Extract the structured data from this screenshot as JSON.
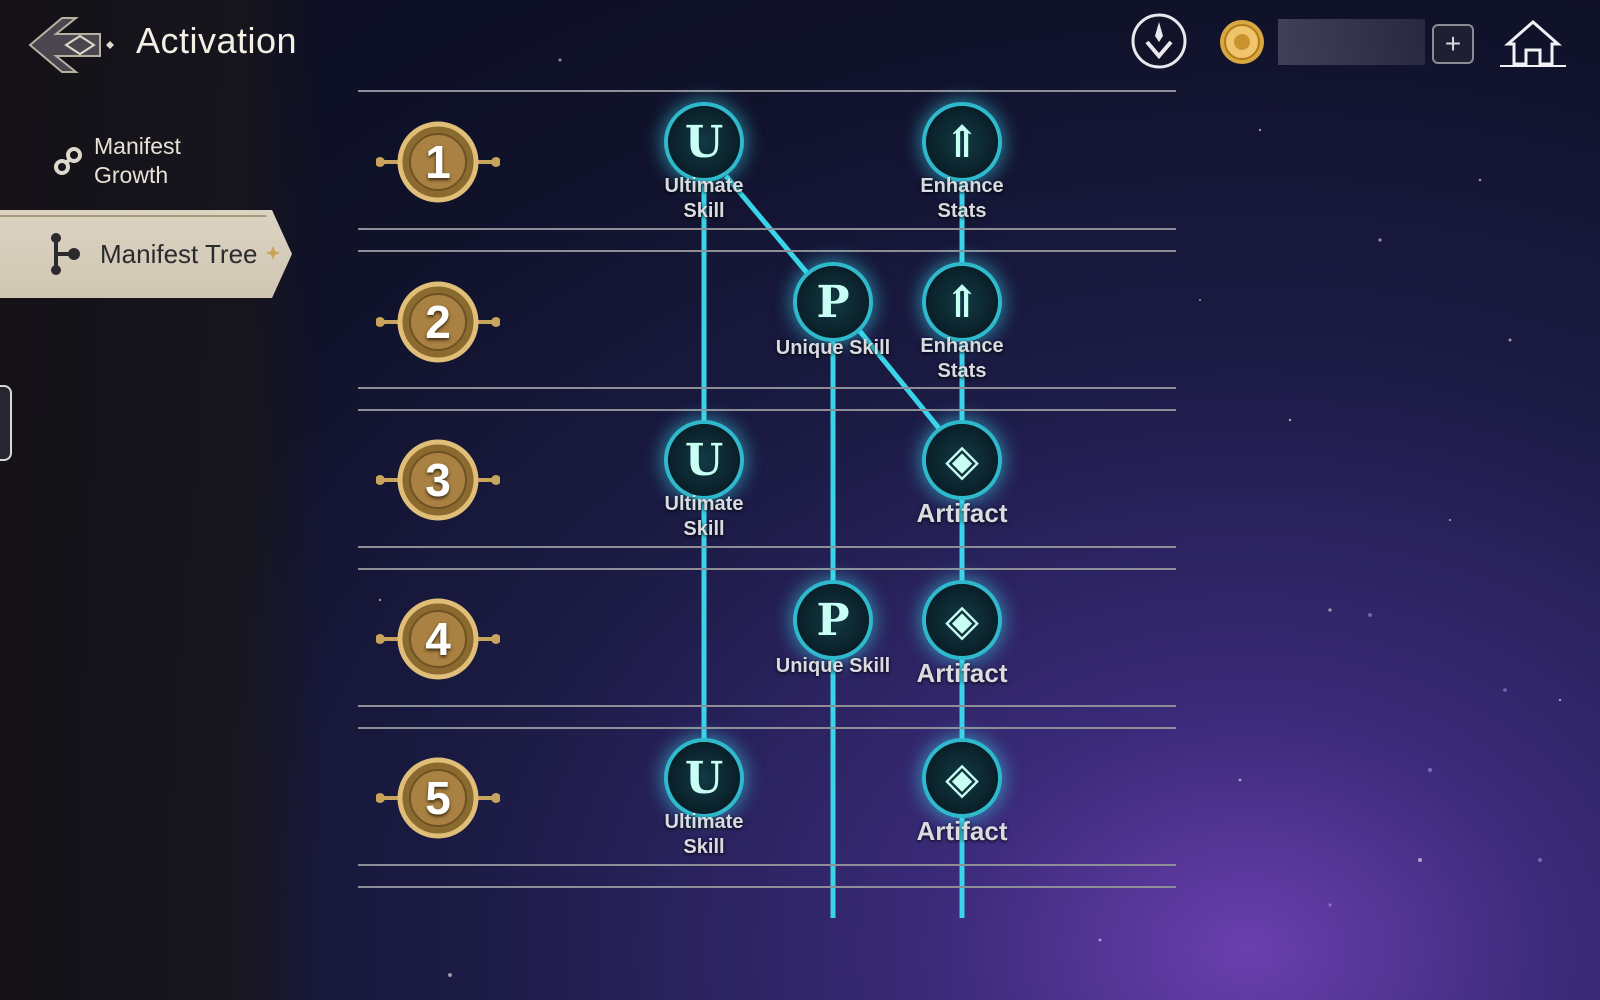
{
  "header": {
    "title": "Activation"
  },
  "sidebar": {
    "items": [
      {
        "label": "Manifest Growth",
        "active": false
      },
      {
        "label": "Manifest Tree",
        "active": true
      }
    ]
  },
  "topbar": {
    "currency_amount": "",
    "icons": [
      "download-icon",
      "gold-coin-icon",
      "plus-icon",
      "home-icon"
    ],
    "plus_label": "+"
  },
  "tree": {
    "levels": [
      {
        "number": "1",
        "nodes": [
          {
            "type": "ultimate",
            "glyph": "U",
            "label": "Ultimate\nSkill"
          },
          {
            "type": "enhance",
            "glyph": "⇑",
            "label": "Enhance\nStats"
          }
        ]
      },
      {
        "number": "2",
        "nodes": [
          {
            "type": "unique",
            "glyph": "P",
            "label": "Unique Skill"
          },
          {
            "type": "enhance",
            "glyph": "⇑",
            "label": "Enhance\nStats"
          }
        ]
      },
      {
        "number": "3",
        "nodes": [
          {
            "type": "ultimate",
            "glyph": "U",
            "label": "Ultimate\nSkill"
          },
          {
            "type": "artifact",
            "glyph": "◈",
            "label": "Artifact"
          }
        ]
      },
      {
        "number": "4",
        "nodes": [
          {
            "type": "unique",
            "glyph": "P",
            "label": "Unique Skill"
          },
          {
            "type": "artifact",
            "glyph": "◈",
            "label": "Artifact"
          }
        ]
      },
      {
        "number": "5",
        "nodes": [
          {
            "type": "ultimate",
            "glyph": "U",
            "label": "Ultimate\nSkill"
          },
          {
            "type": "artifact",
            "glyph": "◈",
            "label": "Artifact"
          }
        ]
      }
    ]
  },
  "colors": {
    "accent": "#3ad4ea",
    "gold": "#c9a45c",
    "panel": "#d8cfbd"
  }
}
